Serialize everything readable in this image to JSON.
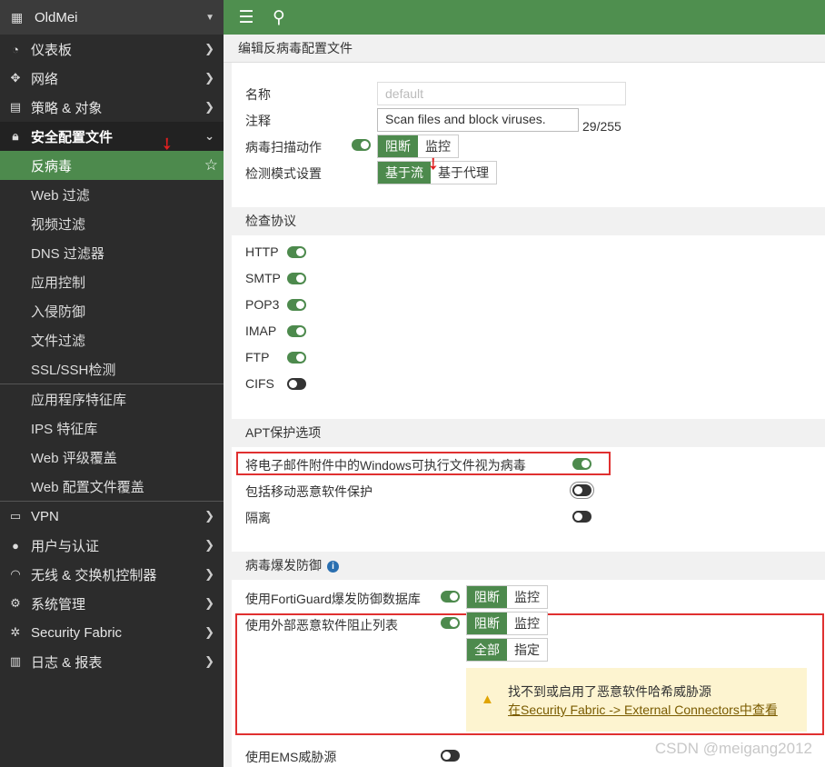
{
  "sidebar": {
    "brand": "OldMei",
    "items": [
      {
        "label": "仪表板",
        "icon": "dashboard-icon"
      },
      {
        "label": "网络",
        "icon": "network-icon"
      },
      {
        "label": "策略 & 对象",
        "icon": "policy-icon"
      },
      {
        "label": "安全配置文件",
        "icon": "lock-icon"
      },
      {
        "label": "VPN",
        "icon": "vpn-icon"
      },
      {
        "label": "用户与认证",
        "icon": "user-icon"
      },
      {
        "label": "无线 & 交换机控制器",
        "icon": "wifi-icon"
      },
      {
        "label": "系统管理",
        "icon": "gear-icon"
      },
      {
        "label": "Security Fabric",
        "icon": "fabric-icon"
      },
      {
        "label": "日志 & 报表",
        "icon": "chart-icon"
      }
    ],
    "security_sub": [
      "反病毒",
      "Web 过滤",
      "视频过滤",
      "DNS 过滤器",
      "应用控制",
      "入侵防御",
      "文件过滤",
      "SSL/SSH检测",
      "应用程序特征库",
      "IPS 特征库",
      "Web 评级覆盖",
      "Web 配置文件覆盖"
    ]
  },
  "page_title": "编辑反病毒配置文件",
  "form": {
    "name_label": "名称",
    "name_placeholder": "default",
    "comment_label": "注释",
    "comment_value": "Scan files and block viruses.",
    "comment_count": "29/255",
    "scan_action_label": "病毒扫描动作",
    "scan_action_options": [
      "阻断",
      "监控"
    ],
    "detect_mode_label": "检测模式设置",
    "detect_mode_options": [
      "基于流",
      "基于代理"
    ]
  },
  "protocols": {
    "title": "检查协议",
    "items": [
      {
        "label": "HTTP",
        "on": true
      },
      {
        "label": "SMTP",
        "on": true
      },
      {
        "label": "POP3",
        "on": true
      },
      {
        "label": "IMAP",
        "on": true
      },
      {
        "label": "FTP",
        "on": true
      },
      {
        "label": "CIFS",
        "on": false
      }
    ]
  },
  "apt": {
    "title": "APT保护选项",
    "items": [
      {
        "label": "将电子邮件附件中的Windows可执行文件视为病毒",
        "on": true
      },
      {
        "label": "包括移动恶意软件保护",
        "on": false
      },
      {
        "label": "隔离",
        "on": false
      }
    ]
  },
  "outbreak": {
    "title": "病毒爆发防御",
    "fortiguard_label": "使用FortiGuard爆发防御数据库",
    "external_label": "使用外部恶意软件阻止列表",
    "action_options": [
      "阻断",
      "监控"
    ],
    "scope_options": [
      "全部",
      "指定"
    ],
    "warning_line1": "找不到或启用了恶意软件哈希威胁源",
    "warning_line2": "在Security Fabric -> External Connectors中查看",
    "ems_label": "使用EMS威胁源"
  },
  "watermark": "CSDN @meigang2012",
  "colors": {
    "accent": "#4d8a4d",
    "sidebar": "#2c2c2c",
    "highlight": "#e03030"
  }
}
